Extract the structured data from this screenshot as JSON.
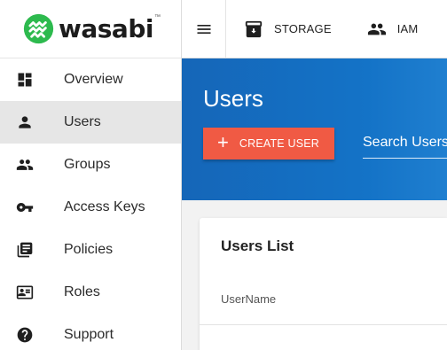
{
  "brand": {
    "name": "wasabi",
    "trademark": "™",
    "color": "#2dba4e"
  },
  "sidebar": {
    "items": [
      {
        "label": "Overview",
        "icon": "dashboard-icon",
        "active": false
      },
      {
        "label": "Users",
        "icon": "person-icon",
        "active": true
      },
      {
        "label": "Groups",
        "icon": "group-icon",
        "active": false
      },
      {
        "label": "Access Keys",
        "icon": "key-icon",
        "active": false
      },
      {
        "label": "Policies",
        "icon": "library-books-icon",
        "active": false
      },
      {
        "label": "Roles",
        "icon": "id-card-icon",
        "active": false
      },
      {
        "label": "Support",
        "icon": "help-icon",
        "active": false
      }
    ]
  },
  "topbar": {
    "storage_label": "STORAGE",
    "iam_label": "IAM"
  },
  "header": {
    "title": "Users",
    "create_button_label": "CREATE USER",
    "search_placeholder": "Search Users"
  },
  "card": {
    "title": "Users List",
    "columns": [
      "UserName"
    ]
  },
  "colors": {
    "accent": "#f05a44",
    "hero": "#1566b8"
  }
}
